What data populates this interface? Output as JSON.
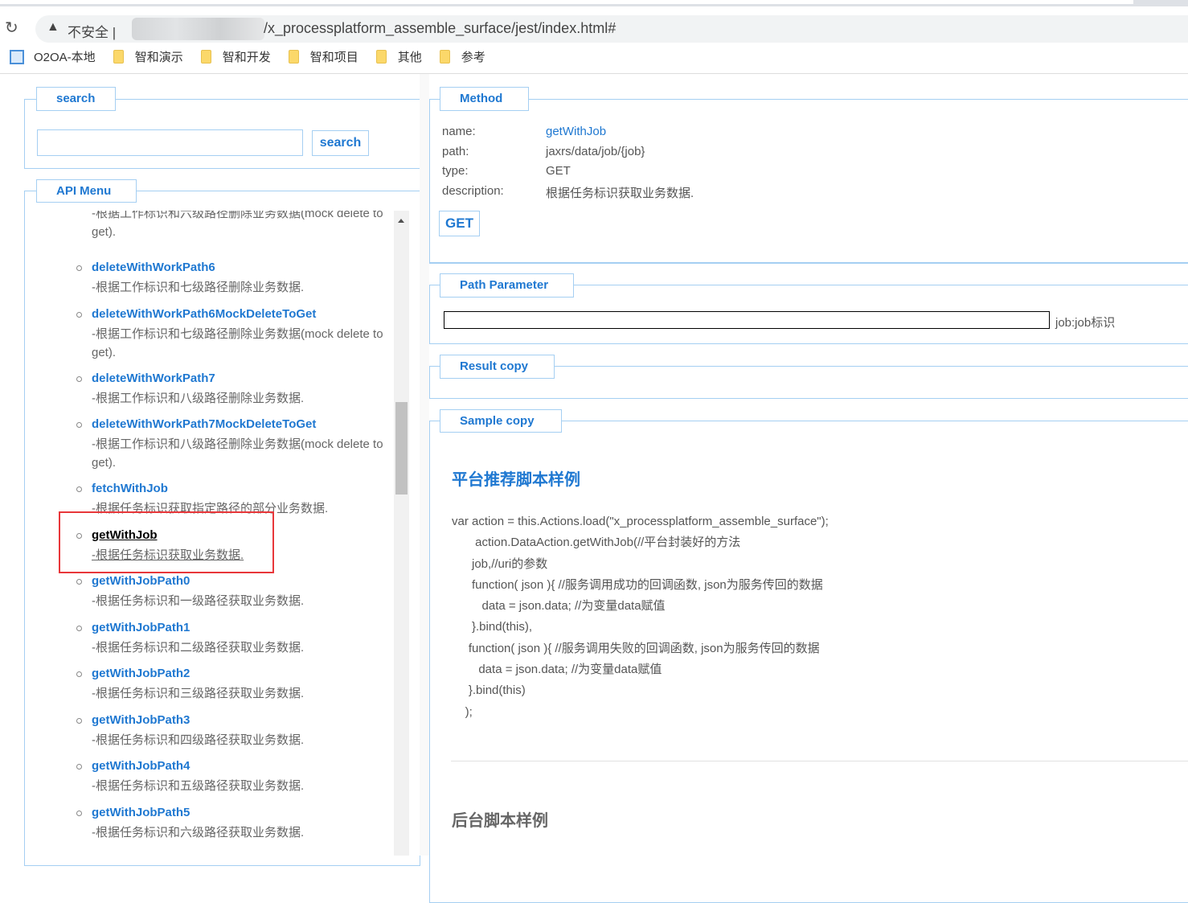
{
  "browser": {
    "insecure_label": "不安全 |",
    "url": "/x_processplatform_assemble_surface/jest/index.html#",
    "bookmarks": [
      "O2OA-本地",
      "智和演示",
      "智和开发",
      "智和项目",
      "其他",
      "参考"
    ]
  },
  "search": {
    "legend": "search",
    "placeholder": "",
    "button": "search"
  },
  "api_menu": {
    "legend": "API Menu",
    "items": [
      {
        "name": "",
        "desc": "-根据工作标识和六级路径删除业务数据(mock delete to get)."
      },
      {
        "name": "deleteWithWorkPath6",
        "desc": "-根据工作标识和七级路径删除业务数据."
      },
      {
        "name": "deleteWithWorkPath6MockDeleteToGet",
        "desc": "-根据工作标识和七级路径删除业务数据(mock delete to get)."
      },
      {
        "name": "deleteWithWorkPath7",
        "desc": "-根据工作标识和八级路径删除业务数据."
      },
      {
        "name": "deleteWithWorkPath7MockDeleteToGet",
        "desc": "-根据工作标识和八级路径删除业务数据(mock delete to get)."
      },
      {
        "name": "fetchWithJob",
        "desc": "-根据任务标识获取指定路径的部分业务数据."
      },
      {
        "name": "getWithJob",
        "desc": "-根据任务标识获取业务数据.",
        "selected": true
      },
      {
        "name": "getWithJobPath0",
        "desc": "-根据任务标识和一级路径获取业务数据."
      },
      {
        "name": "getWithJobPath1",
        "desc": "-根据任务标识和二级路径获取业务数据."
      },
      {
        "name": "getWithJobPath2",
        "desc": "-根据任务标识和三级路径获取业务数据."
      },
      {
        "name": "getWithJobPath3",
        "desc": "-根据任务标识和四级路径获取业务数据."
      },
      {
        "name": "getWithJobPath4",
        "desc": "-根据任务标识和五级路径获取业务数据."
      },
      {
        "name": "getWithJobPath5",
        "desc": "-根据任务标识和六级路径获取业务数据."
      }
    ]
  },
  "method": {
    "legend": "Method",
    "name_label": "name:",
    "name": "getWithJob",
    "path_label": "path:",
    "path": "jaxrs/data/job/{job}",
    "type_label": "type:",
    "type": "GET",
    "desc_label": "description:",
    "desc": "根据任务标识获取业务数据.",
    "button": "GET"
  },
  "path_param": {
    "legend": "Path Parameter",
    "value": "",
    "hint": "job:job标识"
  },
  "result": {
    "legend": "Result copy"
  },
  "sample": {
    "legend": "Sample copy",
    "title1": "平台推荐脚本样例",
    "code": "var action = this.Actions.load(\"x_processplatform_assemble_surface\");\n       action.DataAction.getWithJob(//平台封装好的方法\n      job,//uri的参数\n      function( json ){ //服务调用成功的回调函数, json为服务传回的数据\n         data = json.data; //为变量data赋值\n      }.bind(this),\n     function( json ){ //服务调用失败的回调函数, json为服务传回的数据\n        data = json.data; //为变量data赋值\n     }.bind(this)\n    );",
    "title2": "后台脚本样例"
  },
  "colors": {
    "accent": "#1f78d1",
    "border": "#a5cff2",
    "highlight": "#e8373a"
  }
}
